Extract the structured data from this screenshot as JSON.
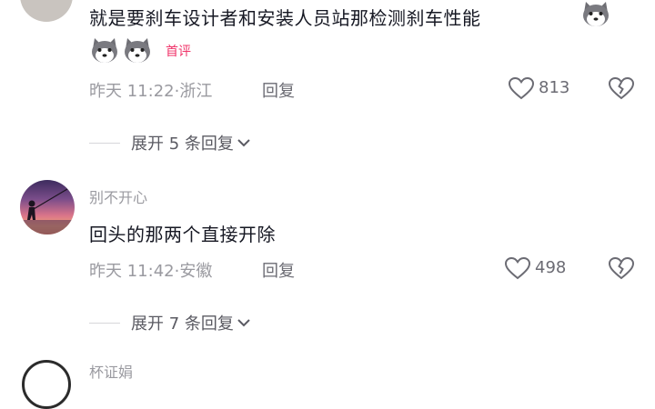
{
  "comment1": {
    "text": "就是要刹车设计者和安装人员站那检测刹车性能",
    "badge": "首评",
    "time": "昨天 11:22",
    "location": "浙江",
    "reply_label": "回复",
    "likes": "813",
    "expand_label": "展开 5 条回复",
    "emoji": "husky-emoji"
  },
  "comment2": {
    "username": "别不开心",
    "text": "回头的那两个直接开除",
    "time": "昨天 11:42",
    "location": "安徽",
    "reply_label": "回复",
    "likes": "498",
    "expand_label": "展开 7 条回复"
  },
  "comment3": {
    "username": "杯证娟"
  },
  "colors": {
    "text": "#161823",
    "meta": "#9a9aa0",
    "badge": "#f0346a",
    "divider": "#d6d6da"
  },
  "icons": [
    "heart-icon",
    "broken-heart-icon",
    "chevron-down-icon",
    "husky-emoji"
  ]
}
